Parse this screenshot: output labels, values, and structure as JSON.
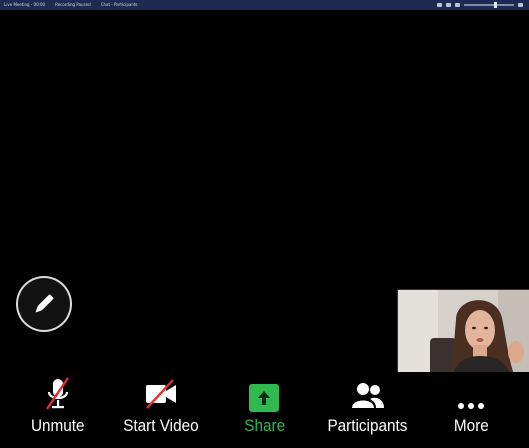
{
  "statusbar": {
    "items": [
      "Live Meeting - 00:00",
      "Recording Paused",
      "Chat - Participants"
    ]
  },
  "stage": {
    "annotate_icon": "pencil-icon",
    "self_view_icon": "participant-video"
  },
  "toolbar": {
    "items": [
      {
        "label": "Unmute",
        "icon": "microphone-muted-icon"
      },
      {
        "label": "Start Video",
        "icon": "video-camera-off-icon"
      },
      {
        "label": "Share",
        "icon": "share-screen-icon",
        "color": "#2fb94f"
      },
      {
        "label": "Participants",
        "icon": "participants-icon"
      },
      {
        "label": "More",
        "icon": "more-dots-icon"
      }
    ]
  },
  "colors": {
    "background": "#000000",
    "accent_green": "#2fb94f",
    "mute_slash_red": "#e02f2f",
    "statusbar": "#1d2b52"
  }
}
